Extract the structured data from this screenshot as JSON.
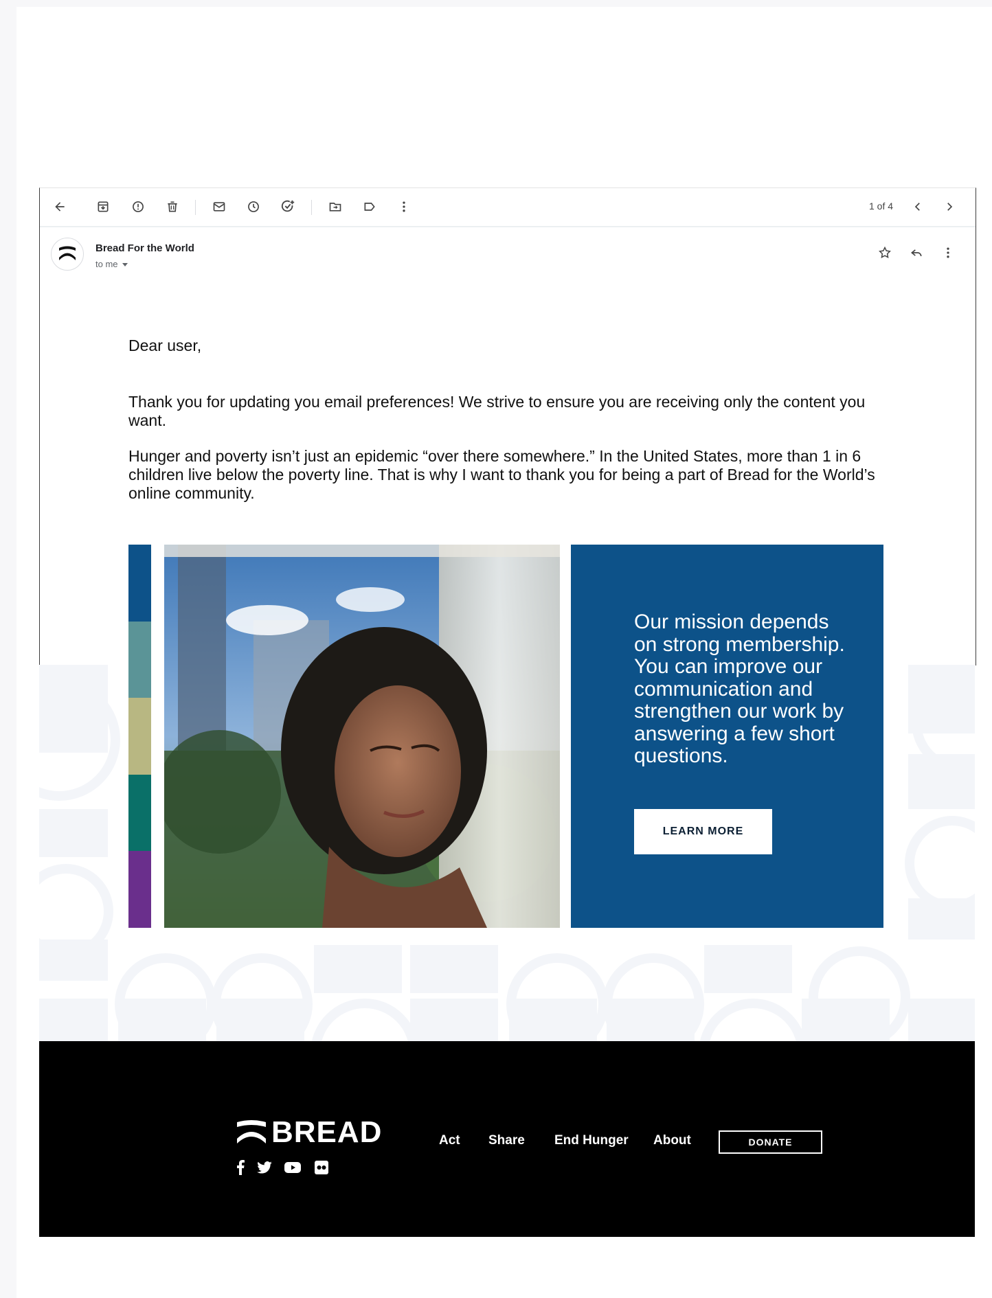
{
  "toolbar": {
    "icons": [
      "back-arrow-icon",
      "archive-icon",
      "report-spam-icon",
      "delete-icon",
      "mark-unread-icon",
      "snooze-icon",
      "add-task-icon",
      "move-to-icon",
      "label-icon",
      "more-vert-icon"
    ],
    "pager": "1 of 4"
  },
  "sender": {
    "name": "Bread For the World",
    "recipient": "to me"
  },
  "body": {
    "greeting": "Dear user,",
    "paragraph1": "Thank you for updating you email preferences! We strive to ensure you are receiving only the content you want.",
    "paragraph2": "Hunger and poverty isn’t just an epidemic “over there somewhere.” In the United States, more than 1 in 6 children live below the poverty line. That is why I want to thank you for being a part of Bread for the World’s online community."
  },
  "stripes": [
    "#0d5289",
    "#5b9497",
    "#b8b782",
    "#0a7068",
    "#6a2f8c"
  ],
  "cta": {
    "text": "Our mission depends on strong membership. You can improve our communication and strengthen our work by answering a few short questions.",
    "button": "LEARN MORE"
  },
  "footer": {
    "brand": "BREAD",
    "social": [
      "facebook-icon",
      "twitter-icon",
      "youtube-icon",
      "flickr-icon"
    ],
    "nav": [
      "Act",
      "Share",
      "End Hunger",
      "About"
    ],
    "donate": "DONATE"
  },
  "colors": {
    "accent_blue": "#0d5289",
    "footer_bg": "#000000"
  }
}
